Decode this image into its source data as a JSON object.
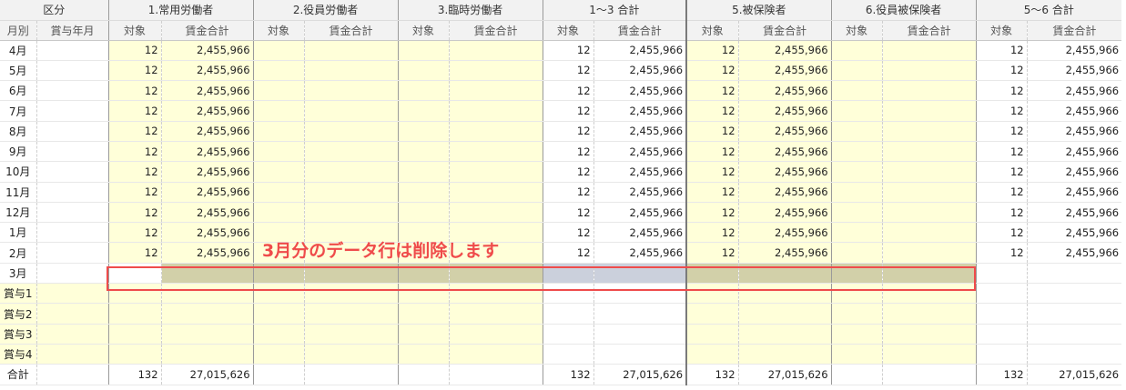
{
  "header": {
    "group_kubun": "区分",
    "groups": [
      "1.常用労働者",
      "2.役員労働者",
      "3.臨時労働者",
      "1〜3 合計",
      "5.被保険者",
      "6.役員被保険者",
      "5〜6 合計"
    ],
    "sub_month": "月別",
    "sub_bonus_month": "賞与年月",
    "sub_count": "対象",
    "sub_wage": "賃金合計"
  },
  "rows": [
    {
      "label": "4月",
      "g1c": "12",
      "g1w": "2,455,966",
      "tc": "12",
      "tw": "2,455,966",
      "g5c": "12",
      "g5w": "2,455,966",
      "t2c": "12",
      "t2w": "2,455,966"
    },
    {
      "label": "5月",
      "g1c": "12",
      "g1w": "2,455,966",
      "tc": "12",
      "tw": "2,455,966",
      "g5c": "12",
      "g5w": "2,455,966",
      "t2c": "12",
      "t2w": "2,455,966"
    },
    {
      "label": "6月",
      "g1c": "12",
      "g1w": "2,455,966",
      "tc": "12",
      "tw": "2,455,966",
      "g5c": "12",
      "g5w": "2,455,966",
      "t2c": "12",
      "t2w": "2,455,966"
    },
    {
      "label": "7月",
      "g1c": "12",
      "g1w": "2,455,966",
      "tc": "12",
      "tw": "2,455,966",
      "g5c": "12",
      "g5w": "2,455,966",
      "t2c": "12",
      "t2w": "2,455,966"
    },
    {
      "label": "8月",
      "g1c": "12",
      "g1w": "2,455,966",
      "tc": "12",
      "tw": "2,455,966",
      "g5c": "12",
      "g5w": "2,455,966",
      "t2c": "12",
      "t2w": "2,455,966"
    },
    {
      "label": "9月",
      "g1c": "12",
      "g1w": "2,455,966",
      "tc": "12",
      "tw": "2,455,966",
      "g5c": "12",
      "g5w": "2,455,966",
      "t2c": "12",
      "t2w": "2,455,966"
    },
    {
      "label": "10月",
      "g1c": "12",
      "g1w": "2,455,966",
      "tc": "12",
      "tw": "2,455,966",
      "g5c": "12",
      "g5w": "2,455,966",
      "t2c": "12",
      "t2w": "2,455,966"
    },
    {
      "label": "11月",
      "g1c": "12",
      "g1w": "2,455,966",
      "tc": "12",
      "tw": "2,455,966",
      "g5c": "12",
      "g5w": "2,455,966",
      "t2c": "12",
      "t2w": "2,455,966"
    },
    {
      "label": "12月",
      "g1c": "12",
      "g1w": "2,455,966",
      "tc": "12",
      "tw": "2,455,966",
      "g5c": "12",
      "g5w": "2,455,966",
      "t2c": "12",
      "t2w": "2,455,966"
    },
    {
      "label": "1月",
      "g1c": "12",
      "g1w": "2,455,966",
      "tc": "12",
      "tw": "2,455,966",
      "g5c": "12",
      "g5w": "2,455,966",
      "t2c": "12",
      "t2w": "2,455,966"
    },
    {
      "label": "2月",
      "g1c": "12",
      "g1w": "2,455,966",
      "tc": "12",
      "tw": "2,455,966",
      "g5c": "12",
      "g5w": "2,455,966",
      "t2c": "12",
      "t2w": "2,455,966"
    },
    {
      "label": "3月",
      "g1c": "",
      "g1w": "",
      "tc": "",
      "tw": "",
      "g5c": "",
      "g5w": "",
      "t2c": "",
      "t2w": ""
    },
    {
      "label": "賞与1",
      "g1c": "",
      "g1w": "",
      "tc": "",
      "tw": "",
      "g5c": "",
      "g5w": "",
      "t2c": "",
      "t2w": ""
    },
    {
      "label": "賞与2",
      "g1c": "",
      "g1w": "",
      "tc": "",
      "tw": "",
      "g5c": "",
      "g5w": "",
      "t2c": "",
      "t2w": ""
    },
    {
      "label": "賞与3",
      "g1c": "",
      "g1w": "",
      "tc": "",
      "tw": "",
      "g5c": "",
      "g5w": "",
      "t2c": "",
      "t2w": ""
    },
    {
      "label": "賞与4",
      "g1c": "",
      "g1w": "",
      "tc": "",
      "tw": "",
      "g5c": "",
      "g5w": "",
      "t2c": "",
      "t2w": ""
    }
  ],
  "total": {
    "label": "合計",
    "g1c": "132",
    "g1w": "27,015,626",
    "tc": "132",
    "tw": "27,015,626",
    "g5c": "132",
    "g5w": "27,015,626",
    "t2c": "132",
    "t2w": "27,015,626"
  },
  "annotation": {
    "note": "3月分のデータ行は削除します",
    "color": "#ef4b4b"
  },
  "colors": {
    "input_fill": "#ffffd9",
    "selected_row": "#d2d0a9",
    "selected_total": "#cbd0dc"
  }
}
